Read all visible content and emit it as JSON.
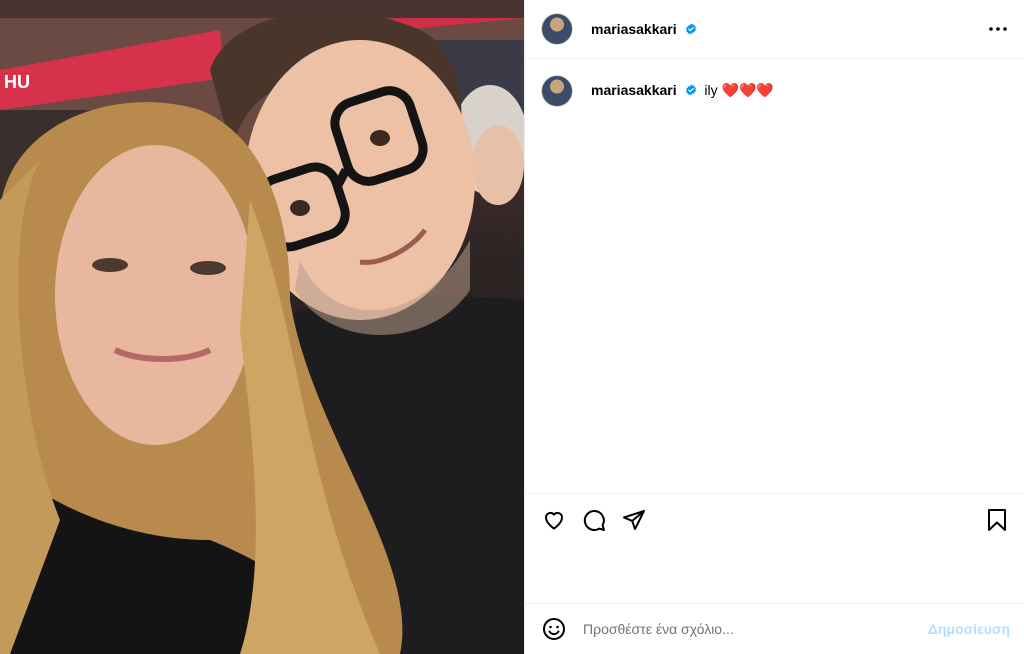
{
  "post": {
    "username": "mariasakkari",
    "verified": true,
    "more_icon": "more-horizontal-icon",
    "caption_username": "mariasakkari",
    "caption_text": "ily ❤️❤️❤️"
  },
  "actions": {
    "like_icon": "heart-icon",
    "comment_icon": "comment-icon",
    "share_icon": "paper-plane-icon",
    "save_icon": "bookmark-icon"
  },
  "comment": {
    "placeholder": "Προσθέστε ένα σχόλιο...",
    "post_label": "Δημοσίευση",
    "emoji_icon": "smiley-icon"
  },
  "photo": {
    "banner_text": "HU",
    "description_icon": "photo"
  },
  "colors": {
    "verified_badge": "#0095f6",
    "post_button_disabled": "#b2dffc",
    "border": "#efefef"
  }
}
